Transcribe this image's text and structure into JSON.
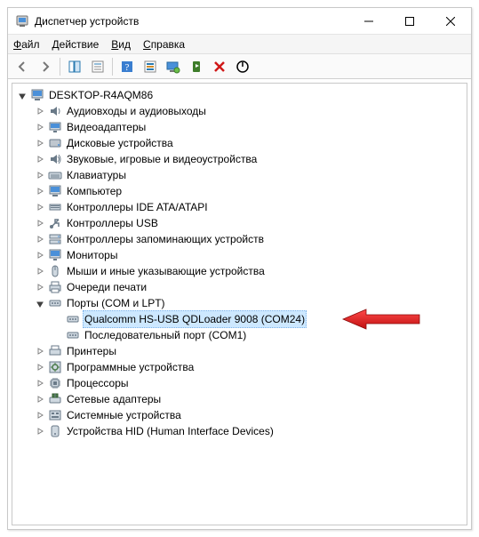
{
  "window": {
    "title": "Диспетчер устройств"
  },
  "menu": {
    "file": {
      "label": "Файл",
      "accel": "Ф"
    },
    "action": {
      "label": "Действие",
      "accel": "Д"
    },
    "view": {
      "label": "Вид",
      "accel": "В"
    },
    "help": {
      "label": "Справка",
      "accel": "С"
    }
  },
  "toolbar": {
    "back": "back-icon",
    "forward": "forward-icon",
    "showhide": "showhide-icon",
    "properties": "properties-icon",
    "help": "help-icon",
    "scan": "scan-icon",
    "monitor": "monitor-icon",
    "enable": "enable-icon",
    "disable": "disable-icon",
    "uninstall": "uninstall-icon"
  },
  "tree": {
    "root": "DESKTOP-R4AQM86",
    "categories": [
      {
        "label": "Аудиовходы и аудиовыходы",
        "icon": "audio",
        "expanded": false
      },
      {
        "label": "Видеоадаптеры",
        "icon": "display",
        "expanded": false
      },
      {
        "label": "Дисковые устройства",
        "icon": "disk",
        "expanded": false
      },
      {
        "label": "Звуковые, игровые и видеоустройства",
        "icon": "sound",
        "expanded": false
      },
      {
        "label": "Клавиатуры",
        "icon": "keyboard",
        "expanded": false
      },
      {
        "label": "Компьютер",
        "icon": "computer",
        "expanded": false
      },
      {
        "label": "Контроллеры IDE ATA/ATAPI",
        "icon": "ide",
        "expanded": false
      },
      {
        "label": "Контроллеры USB",
        "icon": "usb",
        "expanded": false
      },
      {
        "label": "Контроллеры запоминающих устройств",
        "icon": "storage",
        "expanded": false
      },
      {
        "label": "Мониторы",
        "icon": "monitor",
        "expanded": false
      },
      {
        "label": "Мыши и иные указывающие устройства",
        "icon": "mouse",
        "expanded": false
      },
      {
        "label": "Очереди печати",
        "icon": "printq",
        "expanded": false
      },
      {
        "label": "Порты (COM и LPT)",
        "icon": "port",
        "expanded": true,
        "children": [
          {
            "label": "Qualcomm HS-USB QDLoader 9008 (COM24)",
            "icon": "port",
            "selected": true
          },
          {
            "label": "Последовательный порт (COM1)",
            "icon": "port"
          }
        ]
      },
      {
        "label": "Принтеры",
        "icon": "printer",
        "expanded": false
      },
      {
        "label": "Программные устройства",
        "icon": "software",
        "expanded": false
      },
      {
        "label": "Процессоры",
        "icon": "cpu",
        "expanded": false
      },
      {
        "label": "Сетевые адаптеры",
        "icon": "net",
        "expanded": false
      },
      {
        "label": "Системные устройства",
        "icon": "system",
        "expanded": false
      },
      {
        "label": "Устройства HID (Human Interface Devices)",
        "icon": "hid",
        "expanded": false
      }
    ]
  },
  "annotation": {
    "color": "#e11b1b"
  }
}
